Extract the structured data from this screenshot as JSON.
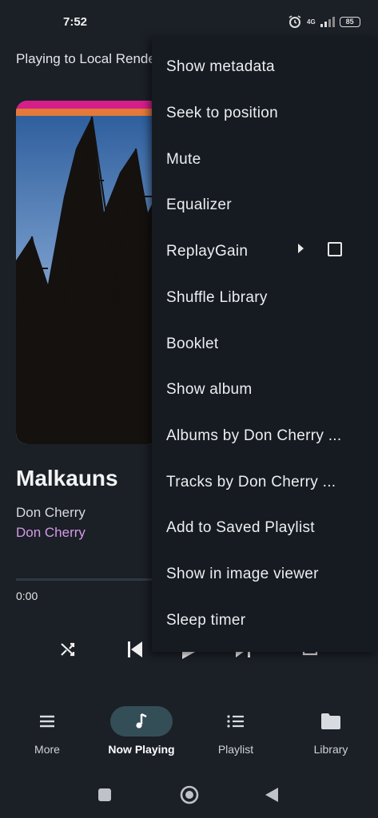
{
  "status_bar": {
    "time": "7:52",
    "network": "4G",
    "battery": "85"
  },
  "cast_status": "Playing to Local Renderer",
  "now_playing": {
    "title": "Malkauns",
    "artist": "Don Cherry",
    "album": "Don Cherry",
    "position": "0:00",
    "progress": 0
  },
  "menu": {
    "items": [
      {
        "label": "Show metadata"
      },
      {
        "label": "Seek to position"
      },
      {
        "label": "Mute"
      },
      {
        "label": "Equalizer"
      },
      {
        "label": "ReplayGain"
      },
      {
        "label": "Shuffle Library"
      },
      {
        "label": "Booklet"
      },
      {
        "label": "Show album"
      },
      {
        "label": "Albums by Don Cherry ..."
      },
      {
        "label": "Tracks by Don Cherry ..."
      },
      {
        "label": "Add to Saved Playlist"
      },
      {
        "label": "Show in image viewer"
      },
      {
        "label": "Sleep timer"
      }
    ],
    "replaygain_checked": false
  },
  "bottom_nav": {
    "items": [
      {
        "label": "More",
        "icon": "menu-icon"
      },
      {
        "label": "Now Playing",
        "icon": "music-note-icon",
        "active": true
      },
      {
        "label": "Playlist",
        "icon": "list-icon"
      },
      {
        "label": "Library",
        "icon": "folder-icon"
      }
    ]
  },
  "colors": {
    "background": "#1b1f26",
    "menu_bg": "#161b21",
    "album_accent": "#d39ae8",
    "nav_active": "#344e58"
  }
}
